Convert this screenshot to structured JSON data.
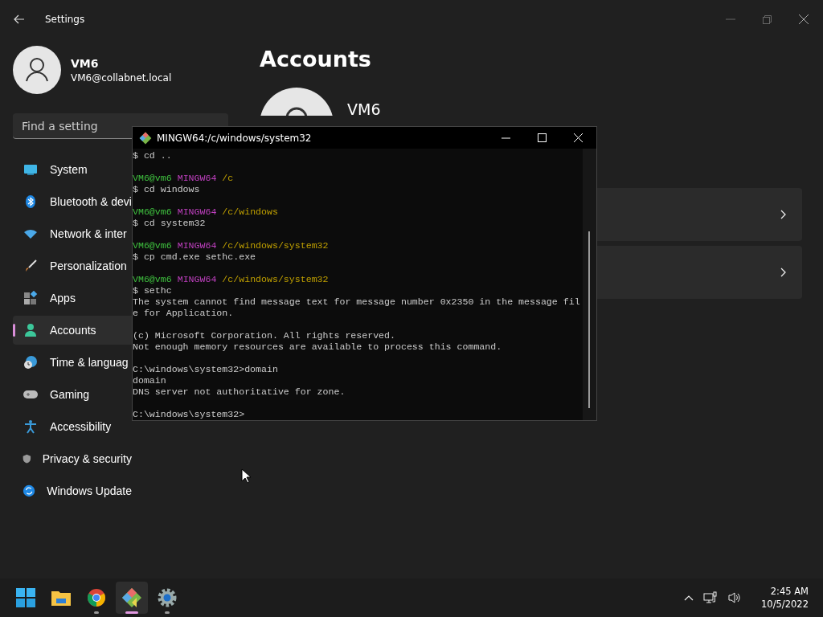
{
  "settings": {
    "title": "Settings",
    "user": {
      "name": "VM6",
      "email": "VM6@collabnet.local"
    },
    "search": {
      "placeholder": "Find a setting"
    },
    "nav": [
      {
        "label": "System",
        "selected": false
      },
      {
        "label": "Bluetooth & devi",
        "selected": false
      },
      {
        "label": "Network & inter",
        "selected": false
      },
      {
        "label": "Personalization",
        "selected": false
      },
      {
        "label": "Apps",
        "selected": false
      },
      {
        "label": "Accounts",
        "selected": true
      },
      {
        "label": "Time & languag",
        "selected": false
      },
      {
        "label": "Gaming",
        "selected": false
      },
      {
        "label": "Accessibility",
        "selected": false
      },
      {
        "label": "Privacy & security",
        "selected": false
      },
      {
        "label": "Windows Update",
        "selected": false
      }
    ],
    "page_title": "Accounts",
    "profile_name": "VM6"
  },
  "terminal": {
    "title": "MINGW64:/c/windows/system32",
    "lines": [
      {
        "kind": "output",
        "text": "$ cd .."
      },
      {
        "kind": "blank"
      },
      {
        "kind": "prompt",
        "user": "VM6@vm6",
        "shell": "MINGW64",
        "path": "/c"
      },
      {
        "kind": "output",
        "text": "$ cd windows"
      },
      {
        "kind": "blank"
      },
      {
        "kind": "prompt",
        "user": "VM6@vm6",
        "shell": "MINGW64",
        "path": "/c/windows"
      },
      {
        "kind": "output",
        "text": "$ cd system32"
      },
      {
        "kind": "blank"
      },
      {
        "kind": "prompt",
        "user": "VM6@vm6",
        "shell": "MINGW64",
        "path": "/c/windows/system32"
      },
      {
        "kind": "output",
        "text": "$ cp cmd.exe sethc.exe"
      },
      {
        "kind": "blank"
      },
      {
        "kind": "prompt",
        "user": "VM6@vm6",
        "shell": "MINGW64",
        "path": "/c/windows/system32"
      },
      {
        "kind": "output",
        "text": "$ sethc"
      },
      {
        "kind": "output",
        "text": "The system cannot find message text for message number 0x2350 in the message fil"
      },
      {
        "kind": "output",
        "text": "e for Application."
      },
      {
        "kind": "blank"
      },
      {
        "kind": "output",
        "text": "(c) Microsoft Corporation. All rights reserved."
      },
      {
        "kind": "output",
        "text": "Not enough memory resources are available to process this command."
      },
      {
        "kind": "blank"
      },
      {
        "kind": "output",
        "text": "C:\\windows\\system32>domain"
      },
      {
        "kind": "output",
        "text": "domain"
      },
      {
        "kind": "output",
        "text": "DNS server not authoritative for zone."
      },
      {
        "kind": "blank"
      },
      {
        "kind": "output",
        "text": "C:\\windows\\system32>"
      }
    ]
  },
  "taskbar": {
    "apps": [
      {
        "selected": false,
        "running": false
      },
      {
        "selected": false,
        "running": false
      },
      {
        "selected": false,
        "running": true
      },
      {
        "selected": true,
        "running": true
      },
      {
        "selected": false,
        "running": true
      }
    ],
    "time": "2:45 AM",
    "date": "10/5/2022"
  }
}
